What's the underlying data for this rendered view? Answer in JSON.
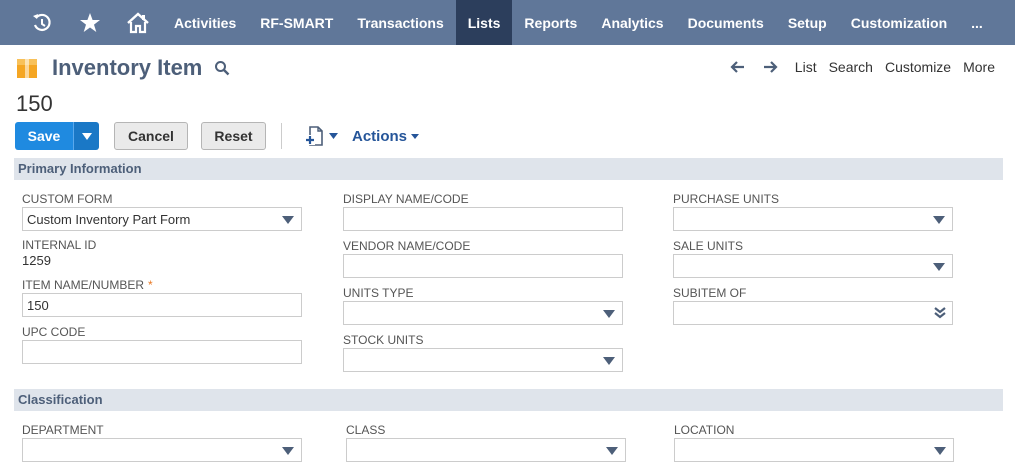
{
  "nav": {
    "items": [
      {
        "label": "Activities",
        "active": false
      },
      {
        "label": "RF-SMART",
        "active": false
      },
      {
        "label": "Transactions",
        "active": false
      },
      {
        "label": "Lists",
        "active": true
      },
      {
        "label": "Reports",
        "active": false
      },
      {
        "label": "Analytics",
        "active": false
      },
      {
        "label": "Documents",
        "active": false
      },
      {
        "label": "Setup",
        "active": false
      },
      {
        "label": "Customization",
        "active": false
      }
    ],
    "more_label": "..."
  },
  "header": {
    "title": "Inventory Item",
    "record_number": "150",
    "links": {
      "list": "List",
      "search": "Search",
      "customize": "Customize",
      "more": "More"
    }
  },
  "toolbar": {
    "save_label": "Save",
    "cancel_label": "Cancel",
    "reset_label": "Reset",
    "actions_label": "Actions"
  },
  "sections": {
    "primary": {
      "title": "Primary Information",
      "custom_form_label": "CUSTOM FORM",
      "custom_form_value": "Custom Inventory Part Form",
      "internal_id_label": "INTERNAL ID",
      "internal_id_value": "1259",
      "item_name_label": "ITEM NAME/NUMBER",
      "item_name_value": "150",
      "upc_label": "UPC CODE",
      "upc_value": "",
      "display_name_label": "DISPLAY NAME/CODE",
      "display_name_value": "",
      "vendor_name_label": "VENDOR NAME/CODE",
      "vendor_name_value": "",
      "units_type_label": "UNITS TYPE",
      "units_type_value": "",
      "stock_units_label": "STOCK UNITS",
      "stock_units_value": "",
      "purchase_units_label": "PURCHASE UNITS",
      "purchase_units_value": "",
      "sale_units_label": "SALE UNITS",
      "sale_units_value": "",
      "subitem_label": "SUBITEM OF",
      "subitem_value": ""
    },
    "classification": {
      "title": "Classification",
      "department_label": "DEPARTMENT",
      "class_label": "CLASS",
      "location_label": "LOCATION"
    }
  },
  "colors": {
    "nav_bg": "#607799",
    "nav_active": "#2c3e5c",
    "save_blue": "#1f8ae0",
    "link_blue": "#255599",
    "required": "#e87722"
  },
  "icons": [
    "history-icon",
    "star-icon",
    "home-icon",
    "search-icon",
    "arrow-left-icon",
    "arrow-right-icon",
    "new-record-icon",
    "chevron-down-icon"
  ]
}
